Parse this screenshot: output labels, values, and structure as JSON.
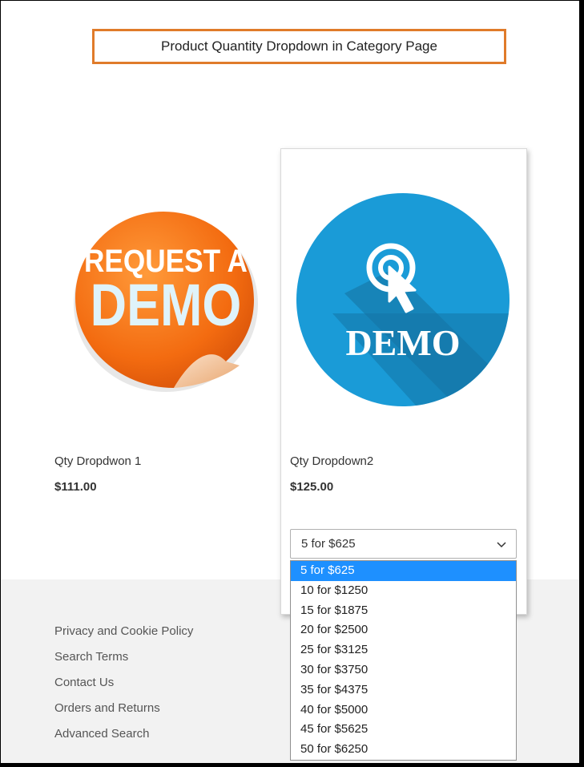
{
  "title": "Product Quantity Dropdown in Category Page",
  "products": [
    {
      "name": "Qty Dropdwon 1",
      "price": "$111.00",
      "image_text_1": "REQUEST A",
      "image_text_2": "DEMO"
    },
    {
      "name": "Qty Dropdown2",
      "price": "$125.00",
      "image_text": "DEMO"
    }
  ],
  "qty_select": {
    "value": "5 for $625",
    "options": [
      "5 for $625",
      "10 for $1250",
      "15 for $1875",
      "20 for $2500",
      "25 for $3125",
      "30 for $3750",
      "35 for $4375",
      "40 for $5000",
      "45 for $5625",
      "50 for $6250"
    ]
  },
  "footer": {
    "links": [
      "Privacy and Cookie Policy",
      "Search Terms",
      "Contact Us",
      "Orders and Returns",
      "Advanced Search"
    ]
  },
  "colors": {
    "accent_border": "#e07b2a",
    "selected_option": "#1e90ff",
    "demo_badge": "#1a9bd7",
    "request_badge": "#f36b10"
  }
}
